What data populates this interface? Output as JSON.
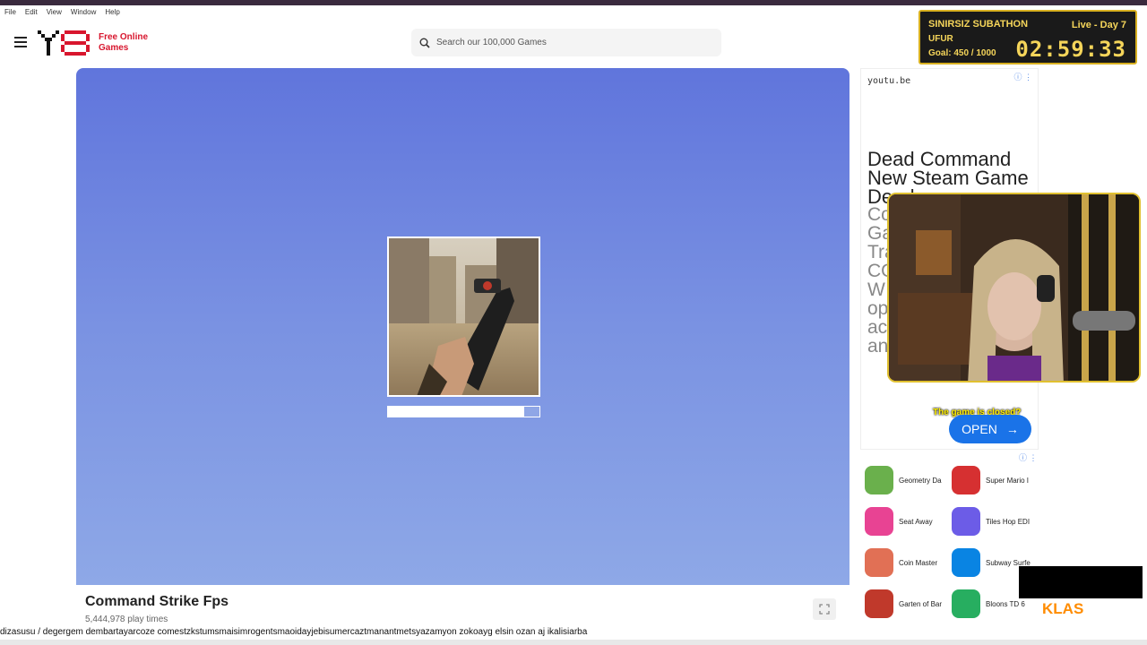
{
  "menubar": {
    "items": [
      "File",
      "Edit",
      "View",
      "Window",
      "Help"
    ]
  },
  "header": {
    "logo_tag_line1": "Free Online",
    "logo_tag_line2": "Games",
    "search_placeholder": "Search our 100,000 Games"
  },
  "stream_widget": {
    "title": "SINIRSIZ SUBATHON",
    "live": "Live - Day 7",
    "name": "UFUR",
    "goal": "Goal: 450 / 1000",
    "timer": "02:59:33"
  },
  "game": {
    "title": "Command Strike Fps",
    "play_count": "5,444,978 play times",
    "loading_progress": 0.9
  },
  "ad": {
    "domain": "youtu.be",
    "headline": "Dead Command New Steam Game Dead",
    "body_letters": "Co Ga Tra CO W op ac an",
    "closed_text": "The game is closed?",
    "open_label": "OPEN"
  },
  "apps": [
    {
      "name": "Geometry Da",
      "color": "#6ab04c"
    },
    {
      "name": "Super Mario I",
      "color": "#d63031"
    },
    {
      "name": "Seat Away",
      "color": "#e84393"
    },
    {
      "name": "Tiles Hop EDI",
      "color": "#6c5ce7"
    },
    {
      "name": "Coin Master",
      "color": "#e17055"
    },
    {
      "name": "Subway Surfe",
      "color": "#0984e3"
    },
    {
      "name": "Garten of Bar",
      "color": "#c0392b"
    },
    {
      "name": "Bloons TD 6",
      "color": "#27ae60"
    }
  ],
  "chat_ticker": "dizasusu / degergem dembartayarcoze comestzkstumsmaisimrogentsmaoidayjebisumercaztmanantmetsyazamyon zokoayg elsin ozan aj ikalisiarba",
  "overlay_badge": "KLAS"
}
